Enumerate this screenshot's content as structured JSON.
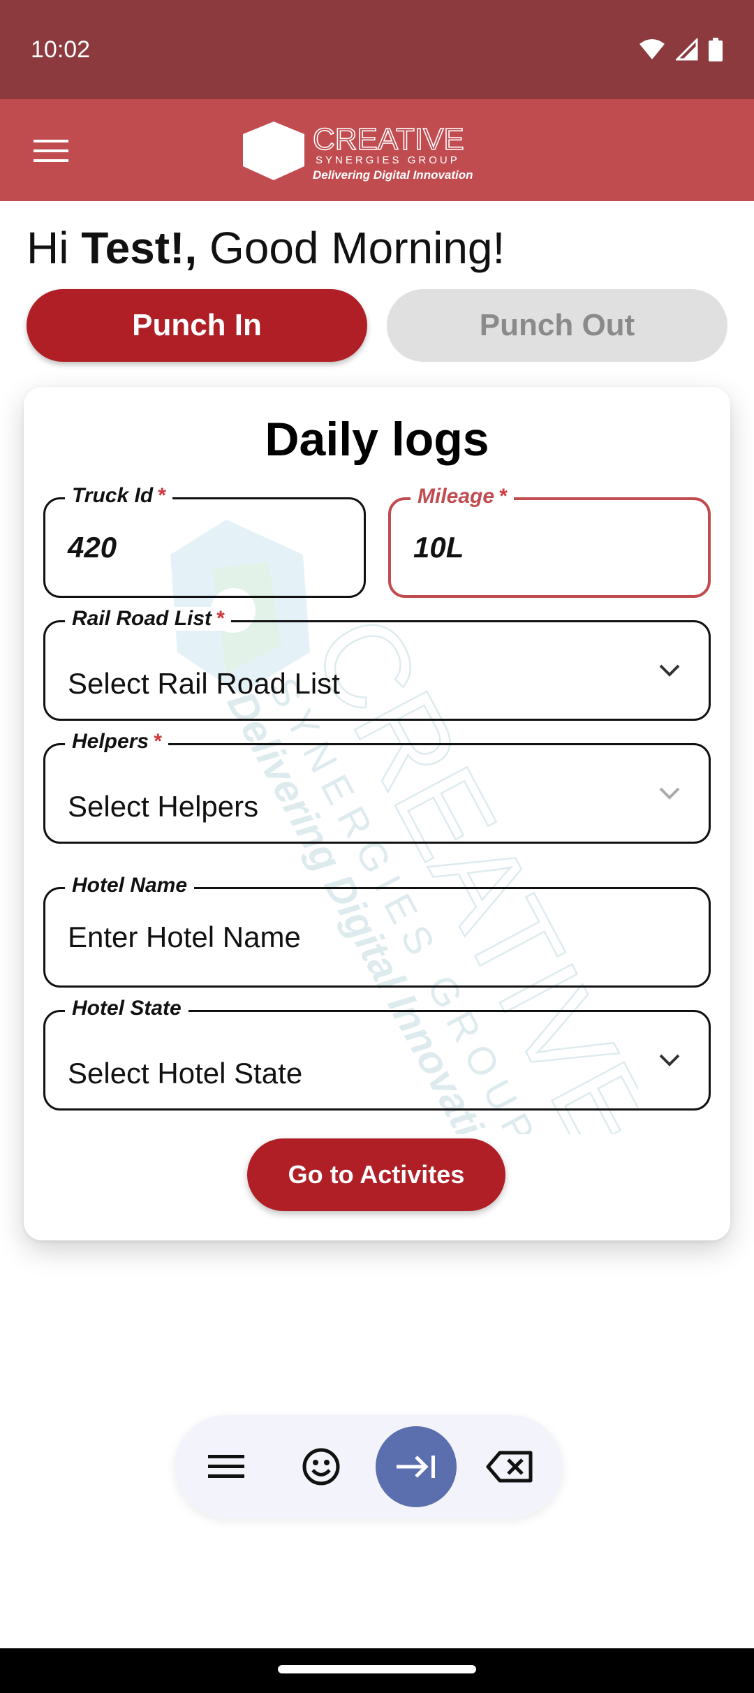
{
  "status_bar": {
    "time": "10:02"
  },
  "app_bar": {
    "logo_title": "CREATIVE",
    "logo_subtitle": "SYNERGIES GROUP",
    "logo_tagline": "Delivering Digital Innovation"
  },
  "greeting": {
    "hi": "Hi ",
    "name": "Test!,",
    "rest": " Good Morning!"
  },
  "punch": {
    "in_label": "Punch In",
    "out_label": "Punch Out"
  },
  "card": {
    "title": "Daily logs",
    "fields": {
      "truck_id": {
        "label": "Truck Id",
        "required": "*",
        "value": "420"
      },
      "mileage": {
        "label": "Mileage",
        "required": "*",
        "value": "10L"
      },
      "rail_road": {
        "label": "Rail Road List",
        "required": "*",
        "value": "Select Rail Road List"
      },
      "helpers": {
        "label": "Helpers",
        "required": "*",
        "value": "Select Helpers"
      },
      "hotel_name": {
        "label": "Hotel Name",
        "placeholder": "Enter Hotel Name"
      },
      "hotel_state": {
        "label": "Hotel State",
        "value": "Select Hotel State"
      }
    },
    "go_button": "Go to Activites"
  },
  "colors": {
    "status_bar": "#8c3a3e",
    "app_bar": "#c14c50",
    "primary": "#b01f26",
    "keyboard_primary": "#5b6fae"
  },
  "keyboard_toolbar": {
    "icons": [
      "menu-icon",
      "emoji-icon",
      "tab-arrow-icon",
      "backspace-icon"
    ]
  }
}
